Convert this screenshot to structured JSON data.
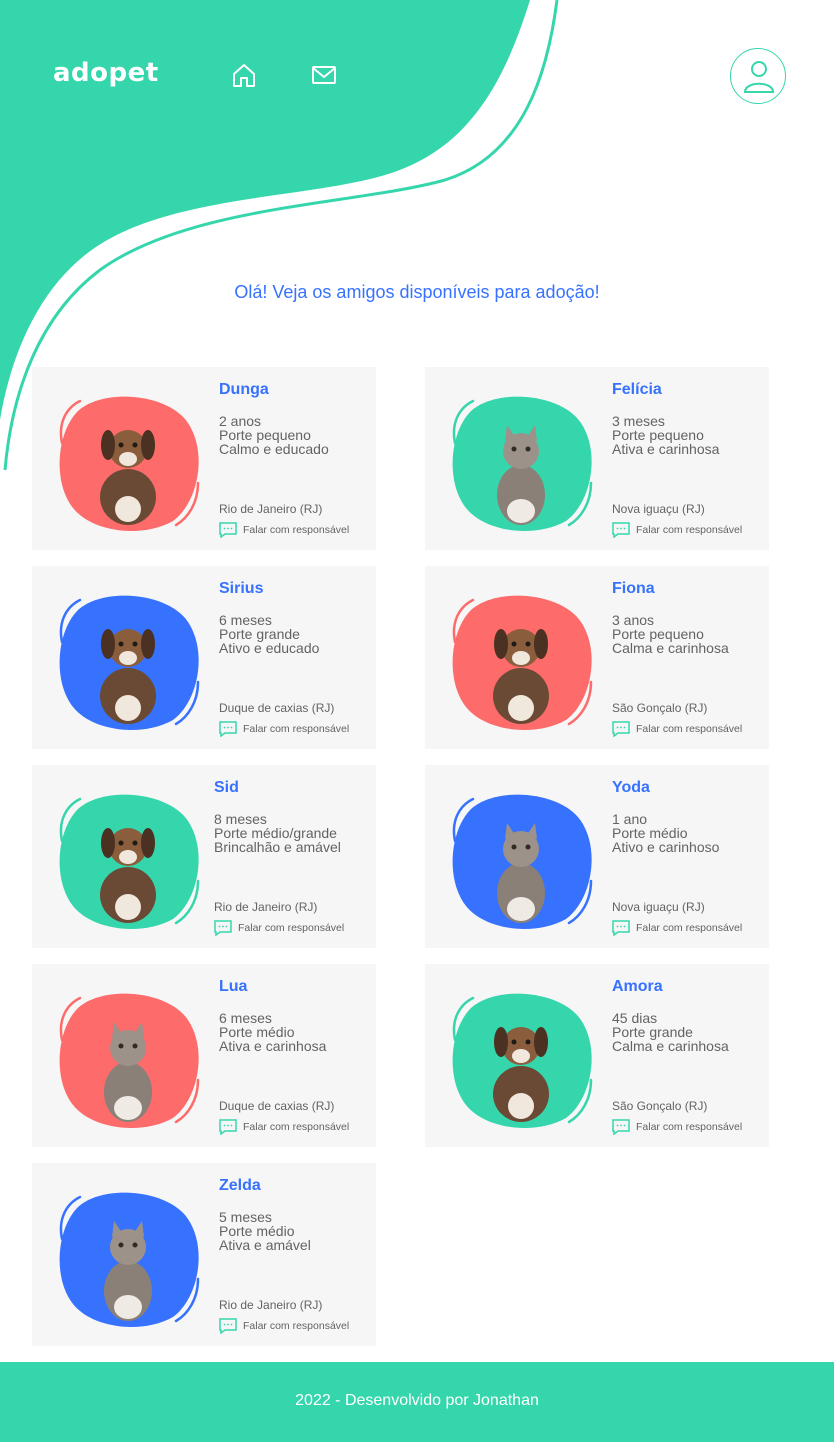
{
  "header": {
    "logo": "adopet"
  },
  "greeting": "Olá! Veja os amigos disponíveis para adoção!",
  "pets": [
    {
      "name": "Dunga",
      "age": "2 anos",
      "size": "Porte pequeno",
      "temper": "Calmo e educado",
      "location": "Rio de Janeiro (RJ)",
      "contact": "Falar com responsável",
      "blob": "#fd6b6b",
      "animal": "dog"
    },
    {
      "name": "Felícia",
      "age": "3 meses",
      "size": "Porte pequeno",
      "temper": "Ativa e carinhosa",
      "location": "Nova iguaçu (RJ)",
      "contact": "Falar com responsável",
      "blob": "#36d6ad",
      "animal": "cat"
    },
    {
      "name": "Sirius",
      "age": "6 meses",
      "size": "Porte grande",
      "temper": "Ativo e educado",
      "location": "Duque de caxias (RJ)",
      "contact": "Falar com responsável",
      "blob": "#3772ff",
      "animal": "dog"
    },
    {
      "name": "Fiona",
      "age": "3 anos",
      "size": "Porte pequeno",
      "temper": "Calma e carinhosa",
      "location": "São Gonçalo (RJ)",
      "contact": "Falar com responsável",
      "blob": "#fd6b6b",
      "animal": "dog"
    },
    {
      "name": "Sid",
      "age": "8 meses",
      "size": "Porte médio/grande",
      "temper": "Brincalhão e amável",
      "location": "Rio de Janeiro (RJ)",
      "contact": "Falar com responsável",
      "blob": "#36d6ad",
      "animal": "dog"
    },
    {
      "name": "Yoda",
      "age": "1 ano",
      "size": "Porte médio",
      "temper": "Ativo e carinhoso",
      "location": "Nova iguaçu (RJ)",
      "contact": "Falar com responsável",
      "blob": "#3772ff",
      "animal": "cat"
    },
    {
      "name": "Lua",
      "age": "6 meses",
      "size": "Porte médio",
      "temper": "Ativa e carinhosa",
      "location": "Duque de caxias (RJ)",
      "contact": "Falar com responsável",
      "blob": "#fd6b6b",
      "animal": "cat"
    },
    {
      "name": "Amora",
      "age": "45 dias",
      "size": "Porte grande",
      "temper": "Calma e carinhosa",
      "location": "São Gonçalo (RJ)",
      "contact": "Falar com responsável",
      "blob": "#36d6ad",
      "animal": "dog"
    },
    {
      "name": "Zelda",
      "age": "5 meses",
      "size": "Porte médio",
      "temper": "Ativa e amável",
      "location": "Rio de Janeiro (RJ)",
      "contact": "Falar com responsável",
      "blob": "#3772ff",
      "animal": "cat"
    }
  ],
  "footer": {
    "text": "2022 - Desenvolvido por Jonathan"
  },
  "colors": {
    "brand": "#36d6ad",
    "accent": "#3772ff",
    "coral": "#fd6b6b",
    "card": "#f6f6f6"
  }
}
